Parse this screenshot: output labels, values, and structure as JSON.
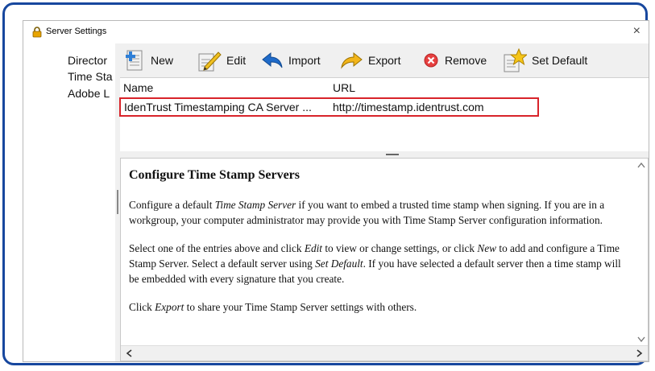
{
  "window": {
    "title": "Server Settings",
    "close_glyph": "×"
  },
  "sidebar": {
    "items": [
      {
        "label": "Director"
      },
      {
        "label": "Time Sta"
      },
      {
        "label": "Adobe L"
      }
    ]
  },
  "toolbar": {
    "new_label": "New",
    "edit_label": "Edit",
    "import_label": "Import",
    "export_label": "Export",
    "remove_label": "Remove",
    "set_default_label": "Set Default"
  },
  "table": {
    "columns": [
      "Name",
      "URL"
    ],
    "rows": [
      {
        "name": "IdenTrust Timestamping CA Server ...",
        "url": "http://timestamp.identrust.com"
      }
    ]
  },
  "help": {
    "heading": "Configure Time Stamp Servers",
    "p1": {
      "a": "Configure a default ",
      "b": "Time Stamp Server",
      "c": " if you want to embed a trusted time stamp when signing. If you are in a workgroup, your computer administrator may provide you with Time Stamp Server configuration information."
    },
    "p2": {
      "a": "Select one of the entries above and click ",
      "b": "Edit",
      "c": " to view or change settings, or click ",
      "d": "New",
      "e": " to add and configure a Time Stamp Server. Select a default server using ",
      "f": "Set Default",
      "g": ". If you have selected a default server then a time stamp will be embedded with every signature that you create."
    },
    "p3": {
      "a": "Click ",
      "b": "Export",
      "c": " to share your Time Stamp Server settings with others."
    }
  },
  "colors": {
    "frame": "#17479e",
    "highlight": "#d8232a"
  },
  "icons": [
    "lock-icon",
    "new-icon",
    "edit-icon",
    "import-icon",
    "export-icon",
    "remove-icon",
    "set-default-icon",
    "close-icon"
  ]
}
